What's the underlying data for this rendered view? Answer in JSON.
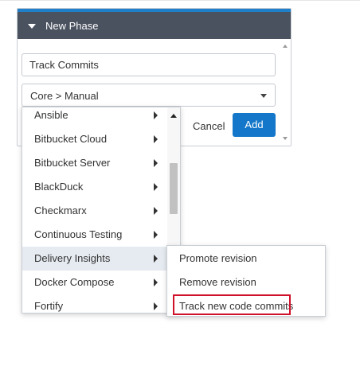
{
  "panel": {
    "title": "New Phase",
    "name_value": "Track Commits",
    "type_value": "Core > Manual",
    "cancel_label": "Cancel",
    "add_label": "Add",
    "accent_color": "#1f7fc8",
    "header_color": "#4a5260",
    "add_button_color": "#1477c9"
  },
  "menu": {
    "items": [
      {
        "label": "Ansible",
        "has_submenu": true
      },
      {
        "label": "Bitbucket Cloud",
        "has_submenu": true
      },
      {
        "label": "Bitbucket Server",
        "has_submenu": true
      },
      {
        "label": "BlackDuck",
        "has_submenu": true
      },
      {
        "label": "Checkmarx",
        "has_submenu": true
      },
      {
        "label": "Continuous Testing",
        "has_submenu": true
      },
      {
        "label": "Delivery Insights",
        "has_submenu": true,
        "active": true
      },
      {
        "label": "Docker Compose",
        "has_submenu": true
      },
      {
        "label": "Fortify",
        "has_submenu": true
      }
    ]
  },
  "submenu": {
    "items": [
      {
        "label": "Promote revision"
      },
      {
        "label": "Remove revision"
      },
      {
        "label": "Track new code commits",
        "highlighted": true
      }
    ],
    "highlight_color": "#d0112b"
  }
}
